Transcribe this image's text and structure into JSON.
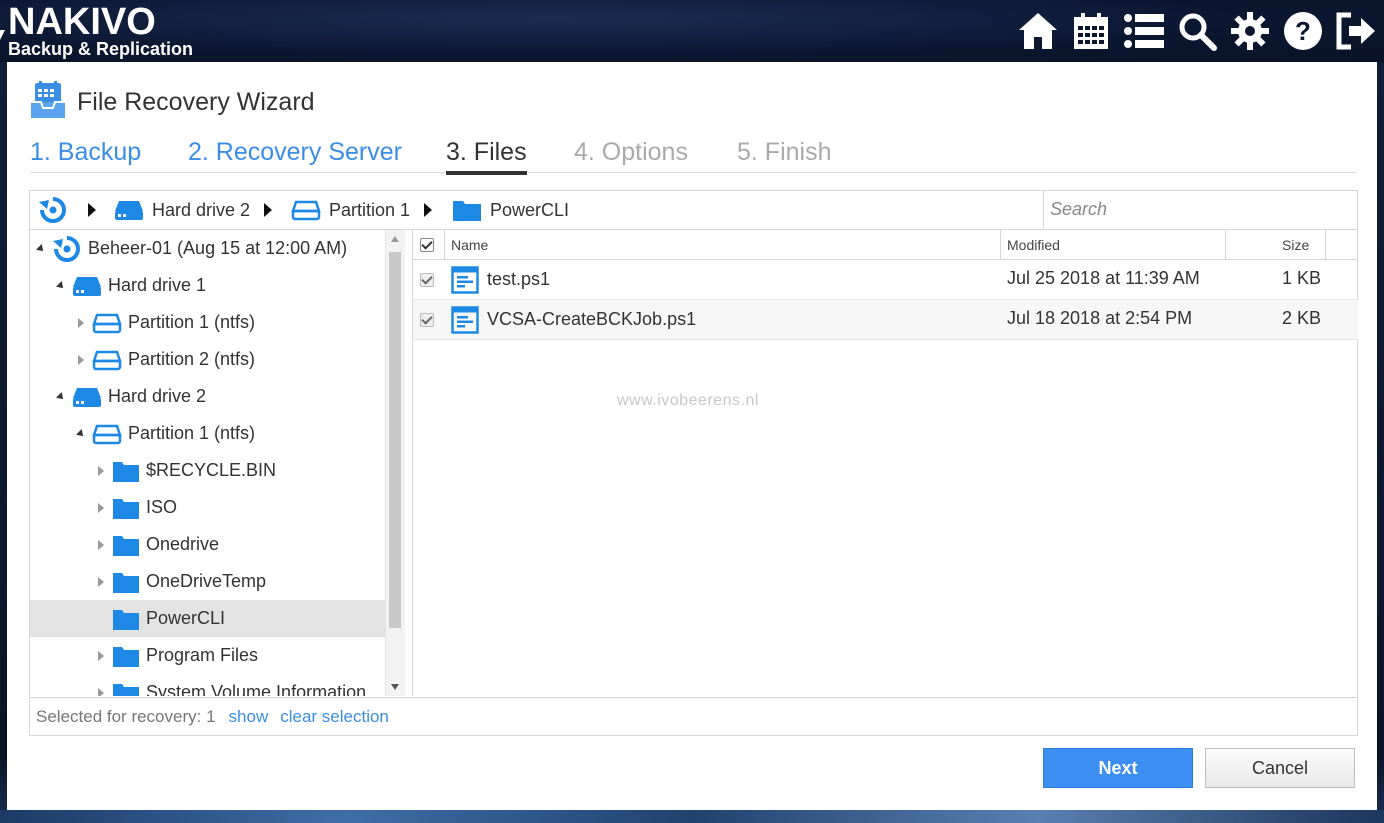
{
  "app": {
    "logo_name": "NAKIVO",
    "logo_subtitle": "Backup & Replication",
    "top_icons": [
      "home-icon",
      "calendar-icon",
      "list-icon",
      "search-icon",
      "gear-icon",
      "help-icon",
      "logout-icon"
    ]
  },
  "wizard": {
    "title": "File Recovery Wizard",
    "steps": [
      {
        "label": "1. Backup",
        "state": "done"
      },
      {
        "label": "2. Recovery Server",
        "state": "done"
      },
      {
        "label": "3. Files",
        "state": "current"
      },
      {
        "label": "4. Options",
        "state": "todo"
      },
      {
        "label": "5. Finish",
        "state": "todo"
      }
    ]
  },
  "breadcrumb": {
    "items": [
      "Hard drive 2",
      "Partition 1",
      "PowerCLI"
    ]
  },
  "search": {
    "placeholder": "Search",
    "value": ""
  },
  "tree": {
    "nodes": [
      {
        "label": "Beheer-01 (Aug 15 at 12:00 AM)",
        "level": 0,
        "icon": "backup-icon",
        "state": "expanded"
      },
      {
        "label": "Hard drive 1",
        "level": 1,
        "icon": "drive-icon",
        "state": "expanded"
      },
      {
        "label": "Partition 1 (ntfs)",
        "level": 2,
        "icon": "partition-icon",
        "state": "collapsed"
      },
      {
        "label": "Partition 2 (ntfs)",
        "level": 2,
        "icon": "partition-icon",
        "state": "collapsed"
      },
      {
        "label": "Hard drive 2",
        "level": 1,
        "icon": "drive-icon",
        "state": "expanded"
      },
      {
        "label": "Partition 1 (ntfs)",
        "level": 2,
        "icon": "partition-icon",
        "state": "expanded"
      },
      {
        "label": "$RECYCLE.BIN",
        "level": 3,
        "icon": "folder-icon",
        "state": "collapsed"
      },
      {
        "label": "ISO",
        "level": 3,
        "icon": "folder-icon",
        "state": "collapsed"
      },
      {
        "label": "Onedrive",
        "level": 3,
        "icon": "folder-icon",
        "state": "collapsed"
      },
      {
        "label": "OneDriveTemp",
        "level": 3,
        "icon": "folder-icon",
        "state": "collapsed"
      },
      {
        "label": "PowerCLI",
        "level": 3,
        "icon": "folder-icon",
        "state": "selected"
      },
      {
        "label": "Program Files",
        "level": 3,
        "icon": "folder-icon",
        "state": "collapsed"
      },
      {
        "label": "System Volume Information",
        "level": 3,
        "icon": "folder-icon",
        "state": "collapsed"
      }
    ]
  },
  "files": {
    "columns": {
      "name": "Name",
      "modified": "Modified",
      "size": "Size"
    },
    "rows": [
      {
        "name": "test.ps1",
        "modified": "Jul 25 2018 at 11:39 AM",
        "size": "1 KB",
        "checked": true
      },
      {
        "name": "VCSA-CreateBCKJob.ps1",
        "modified": "Jul 18 2018 at 2:54 PM",
        "size": "2 KB",
        "checked": true
      }
    ],
    "watermark": "www.ivobeerens.nl"
  },
  "selection": {
    "label": "Selected for recovery: 1",
    "show": "show",
    "clear": "clear selection"
  },
  "buttons": {
    "next": "Next",
    "cancel": "Cancel"
  },
  "colors": {
    "accent": "#3a8ee6",
    "primary_button": "#3d8ef2",
    "icon_blue": "#1e88e5"
  }
}
